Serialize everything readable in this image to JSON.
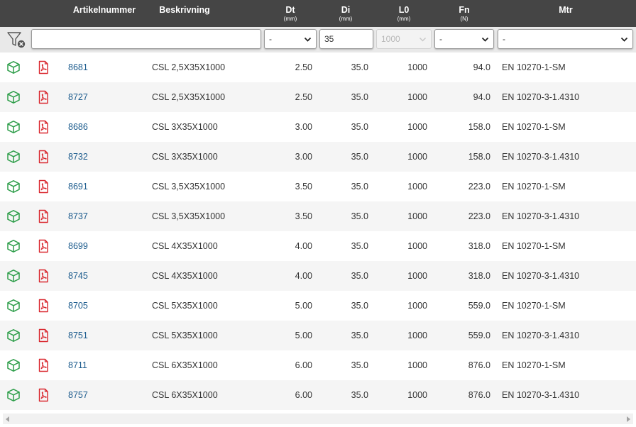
{
  "header": {
    "columns": [
      {
        "key": "artikelnummer",
        "label": "Artikelnummer",
        "unit": ""
      },
      {
        "key": "beskrivning",
        "label": "Beskrivning",
        "unit": ""
      },
      {
        "key": "dt",
        "label": "Dt",
        "unit": "(mm)"
      },
      {
        "key": "di",
        "label": "Di",
        "unit": "(mm)"
      },
      {
        "key": "l0",
        "label": "L0",
        "unit": "(mm)"
      },
      {
        "key": "fn",
        "label": "Fn",
        "unit": "(N)"
      },
      {
        "key": "mtr",
        "label": "Mtr",
        "unit": ""
      }
    ]
  },
  "filters": {
    "artikel_value": "",
    "dt_value": "-",
    "di_value": "35",
    "l0_value": "1000",
    "fn_value": "-",
    "mtr_value": "-"
  },
  "colors": {
    "header_bg": "#454545",
    "filter_bg": "#e9e9e9",
    "alt_row": "#f5f5f5",
    "cube_green": "#2e9e4a",
    "pdf_red": "#d9272e",
    "link_blue": "#1a5a8c"
  },
  "icons": {
    "row_model": "cube-icon",
    "row_doc": "pdf-icon",
    "filter_clear": "filter-clear-icon"
  },
  "rows": [
    {
      "art": "8681",
      "desc": "CSL 2,5X35X1000",
      "dt": "2.50",
      "di": "35.0",
      "l0": "1000",
      "fn": "94.0",
      "mtr": "EN 10270-1-SM"
    },
    {
      "art": "8727",
      "desc": "CSL 2,5X35X1000",
      "dt": "2.50",
      "di": "35.0",
      "l0": "1000",
      "fn": "94.0",
      "mtr": "EN 10270-3-1.4310"
    },
    {
      "art": "8686",
      "desc": "CSL 3X35X1000",
      "dt": "3.00",
      "di": "35.0",
      "l0": "1000",
      "fn": "158.0",
      "mtr": "EN 10270-1-SM"
    },
    {
      "art": "8732",
      "desc": "CSL 3X35X1000",
      "dt": "3.00",
      "di": "35.0",
      "l0": "1000",
      "fn": "158.0",
      "mtr": "EN 10270-3-1.4310"
    },
    {
      "art": "8691",
      "desc": "CSL 3,5X35X1000",
      "dt": "3.50",
      "di": "35.0",
      "l0": "1000",
      "fn": "223.0",
      "mtr": "EN 10270-1-SM"
    },
    {
      "art": "8737",
      "desc": "CSL 3,5X35X1000",
      "dt": "3.50",
      "di": "35.0",
      "l0": "1000",
      "fn": "223.0",
      "mtr": "EN 10270-3-1.4310"
    },
    {
      "art": "8699",
      "desc": "CSL 4X35X1000",
      "dt": "4.00",
      "di": "35.0",
      "l0": "1000",
      "fn": "318.0",
      "mtr": "EN 10270-1-SM"
    },
    {
      "art": "8745",
      "desc": "CSL 4X35X1000",
      "dt": "4.00",
      "di": "35.0",
      "l0": "1000",
      "fn": "318.0",
      "mtr": "EN 10270-3-1.4310"
    },
    {
      "art": "8705",
      "desc": "CSL 5X35X1000",
      "dt": "5.00",
      "di": "35.0",
      "l0": "1000",
      "fn": "559.0",
      "mtr": "EN 10270-1-SM"
    },
    {
      "art": "8751",
      "desc": "CSL 5X35X1000",
      "dt": "5.00",
      "di": "35.0",
      "l0": "1000",
      "fn": "559.0",
      "mtr": "EN 10270-3-1.4310"
    },
    {
      "art": "8711",
      "desc": "CSL 6X35X1000",
      "dt": "6.00",
      "di": "35.0",
      "l0": "1000",
      "fn": "876.0",
      "mtr": "EN 10270-1-SM"
    },
    {
      "art": "8757",
      "desc": "CSL 6X35X1000",
      "dt": "6.00",
      "di": "35.0",
      "l0": "1000",
      "fn": "876.0",
      "mtr": "EN 10270-3-1.4310"
    }
  ]
}
